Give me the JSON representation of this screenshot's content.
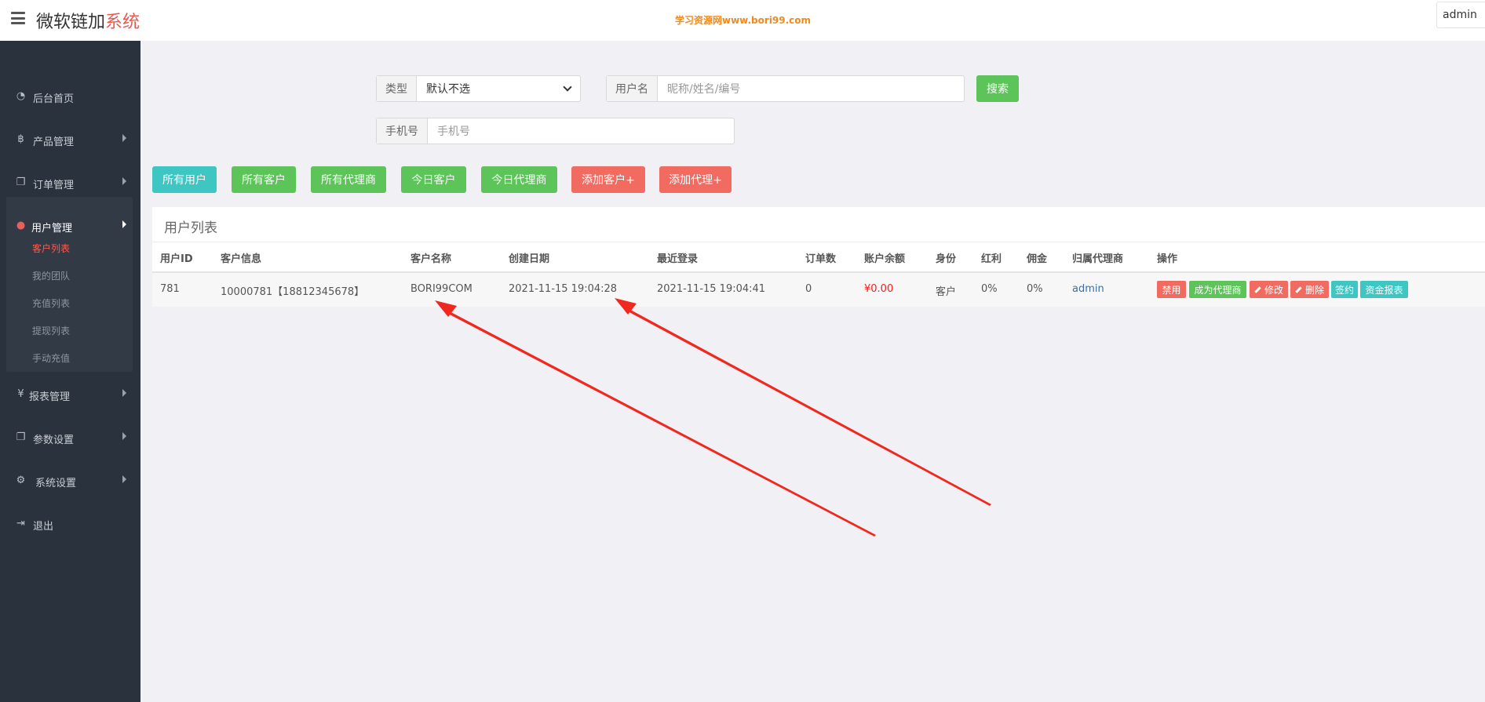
{
  "header": {
    "brand_main": "微软链加",
    "brand_accent": "系统",
    "watermark": "学习资源网www.bori99.com",
    "user": "admin"
  },
  "sidebar": {
    "items": [
      {
        "label": "后台首页",
        "icon": "dashboard-icon"
      },
      {
        "label": "产品管理",
        "icon": "bitcoin-icon"
      },
      {
        "label": "订单管理",
        "icon": "copy-icon"
      },
      {
        "label": "用户管理",
        "icon": "user-icon"
      },
      {
        "label": "报表管理",
        "icon": "yen-icon"
      },
      {
        "label": "参数设置",
        "icon": "copy-icon"
      },
      {
        "label": "系统设置",
        "icon": "gears-icon"
      },
      {
        "label": "退出",
        "icon": "sign-out-icon"
      }
    ],
    "subitems": [
      {
        "label": "客户列表"
      },
      {
        "label": "我的团队"
      },
      {
        "label": "充值列表"
      },
      {
        "label": "提现列表"
      },
      {
        "label": "手动充值"
      }
    ]
  },
  "search": {
    "type_label": "类型",
    "type_value": "默认不选",
    "username_label": "用户名",
    "username_placeholder": "昵称/姓名/编号",
    "search_button": "搜索",
    "phone_label": "手机号",
    "phone_placeholder": "手机号"
  },
  "filters": [
    {
      "label": "所有用户"
    },
    {
      "label": "所有客户"
    },
    {
      "label": "所有代理商"
    },
    {
      "label": "今日客户"
    },
    {
      "label": "今日代理商"
    },
    {
      "label": "添加客户+"
    },
    {
      "label": "添加代理+"
    }
  ],
  "table": {
    "title": "用户列表",
    "columns": [
      "用户ID",
      "客户信息",
      "客户名称",
      "创建日期",
      "最近登录",
      "订单数",
      "账户余额",
      "身份",
      "红利",
      "佣金",
      "归属代理商",
      "操作"
    ],
    "rows": [
      {
        "id": "781",
        "info": "10000781【18812345678】",
        "name": "BORI99COM",
        "created": "2021-11-15 19:04:28",
        "last_login": "2021-11-15 19:04:41",
        "orders": "0",
        "balance": "¥0.00",
        "role": "客户",
        "bonus": "0%",
        "commission": "0%",
        "agent": "admin",
        "actions": [
          "禁用",
          "成为代理商",
          "修改",
          "删除",
          "签约",
          "资金报表"
        ]
      }
    ]
  },
  "colors": {
    "sidebar_bg": "#2a323d",
    "accent_red": "#f26b61",
    "green": "#5cc459",
    "teal": "#3dc6c2",
    "arrow": "#f0281e"
  }
}
